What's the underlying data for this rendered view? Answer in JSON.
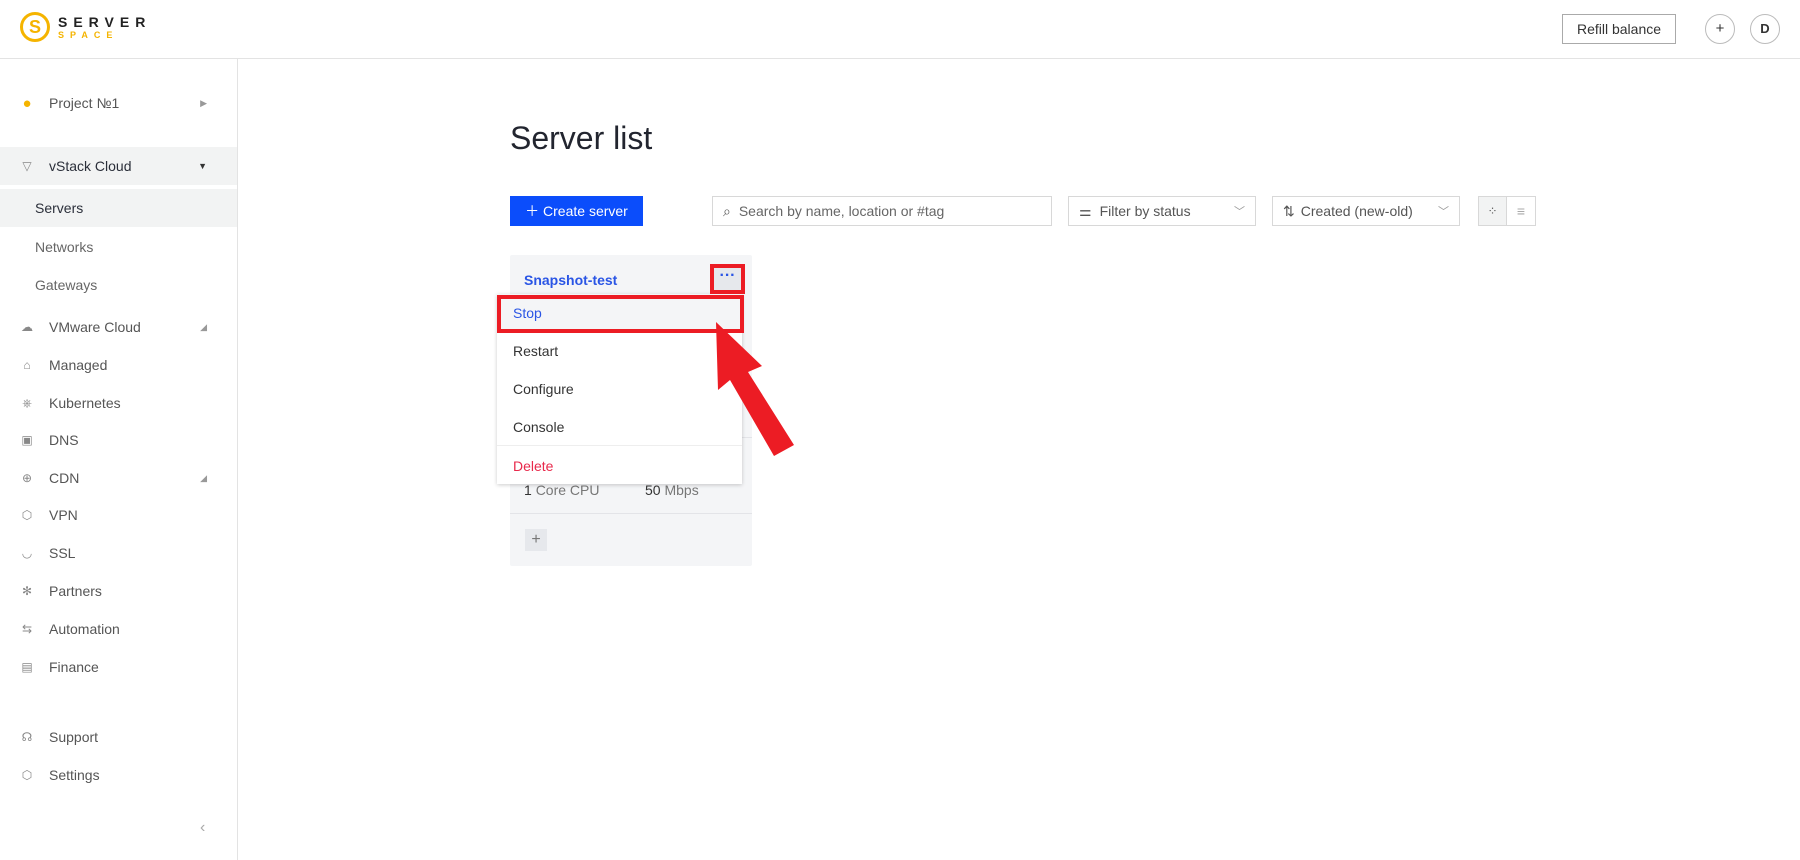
{
  "header": {
    "logo_line1": "SERVER",
    "logo_line2": "SPACE",
    "refill": "Refill balance",
    "avatar": "D"
  },
  "sidebar": {
    "project": "Project №1",
    "vstack": "vStack Cloud",
    "sub": [
      "Servers",
      "Networks",
      "Gateways"
    ],
    "items": [
      "VMware Cloud",
      "Managed",
      "Kubernetes",
      "DNS",
      "CDN",
      "VPN",
      "SSL",
      "Partners",
      "Automation",
      "Finance"
    ],
    "bottom": [
      "Support",
      "Settings"
    ]
  },
  "main": {
    "title": "Server list",
    "create": "Create server",
    "search_placeholder": "Search by name, location or #tag",
    "filter": "Filter by status",
    "sort": "Created (new-old)"
  },
  "card": {
    "name": "Snapshot-test",
    "cpu_n": "1",
    "cpu": "Core CPU",
    "bw_n": "50",
    "bw": "Mbps"
  },
  "menu": [
    "Stop",
    "Restart",
    "Configure",
    "Console",
    "Delete"
  ],
  "colors": {
    "accent": "#0b4dfb",
    "danger": "#e8294b",
    "highlight": "#ec1c24",
    "brand": "#f5b400"
  }
}
